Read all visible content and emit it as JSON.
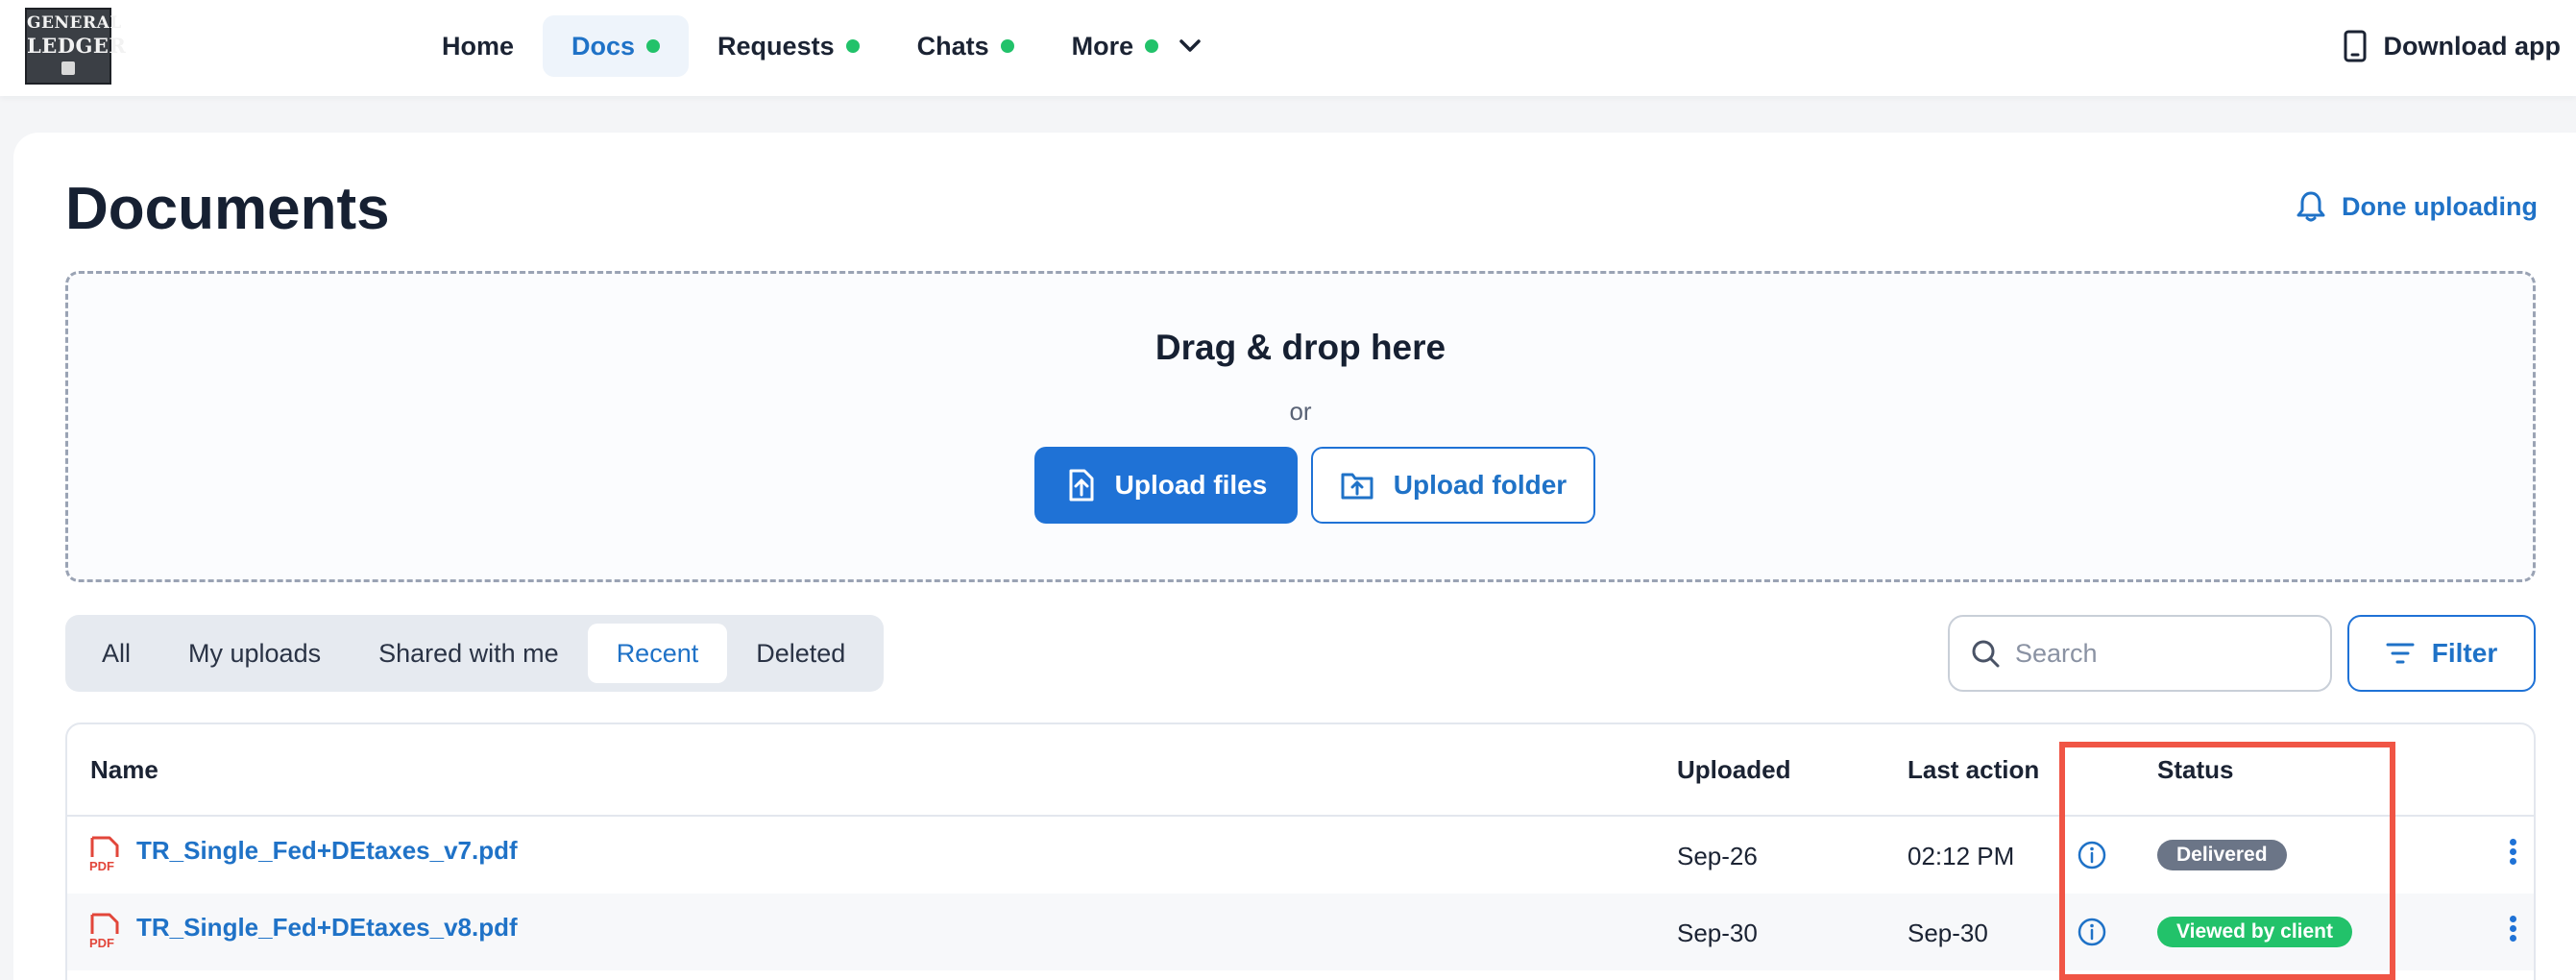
{
  "logo": {
    "line1": "GENERAL",
    "line2": "LEDGER"
  },
  "nav": {
    "items": [
      {
        "label": "Home",
        "dot": false,
        "active": false
      },
      {
        "label": "Docs",
        "dot": true,
        "active": true
      },
      {
        "label": "Requests",
        "dot": true,
        "active": false
      },
      {
        "label": "Chats",
        "dot": true,
        "active": false
      },
      {
        "label": "More",
        "dot": true,
        "active": false
      }
    ],
    "download_label": "Download app"
  },
  "page": {
    "title": "Documents",
    "done_uploading_label": "Done uploading"
  },
  "dropzone": {
    "title": "Drag & drop here",
    "or": "or",
    "upload_files_label": "Upload files",
    "upload_folder_label": "Upload folder"
  },
  "tabs": [
    {
      "label": "All",
      "active": false
    },
    {
      "label": "My uploads",
      "active": false
    },
    {
      "label": "Shared with me",
      "active": false
    },
    {
      "label": "Recent",
      "active": true
    },
    {
      "label": "Deleted",
      "active": false
    }
  ],
  "search": {
    "placeholder": "Search"
  },
  "filter_label": "Filter",
  "table": {
    "headers": {
      "name": "Name",
      "uploaded": "Uploaded",
      "last_action": "Last action",
      "status": "Status"
    },
    "rows": [
      {
        "name": "TR_Single_Fed+DEtaxes_v7.pdf",
        "uploaded": "Sep-26",
        "last_action": "02:12 PM",
        "status": "Delivered",
        "status_color": "#6b7587"
      },
      {
        "name": "TR_Single_Fed+DEtaxes_v8.pdf",
        "uploaded": "Sep-30",
        "last_action": "Sep-30",
        "status": "Viewed by client",
        "status_color": "#22c26a"
      }
    ]
  },
  "colors": {
    "accent": "#1f72d6",
    "dot_green": "#22c26a",
    "highlight": "#f05545",
    "pdf_red": "#e2463a"
  }
}
